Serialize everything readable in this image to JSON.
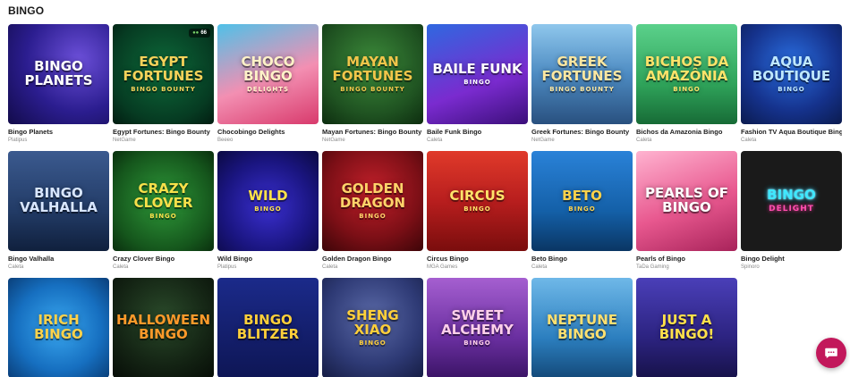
{
  "section": {
    "title": "BINGO"
  },
  "games": [
    {
      "name": "Bingo Planets",
      "provider": "Platipus",
      "art": "Bingo Planets"
    },
    {
      "name": "Egypt Fortunes: Bingo Bounty",
      "provider": "NetGame",
      "art": "Egypt Fortunes",
      "art_sub": "Bingo Bounty",
      "badge": "66"
    },
    {
      "name": "Chocobingo Delights",
      "provider": "Beeeo",
      "art": "Choco Bingo",
      "art_sub": "Delights"
    },
    {
      "name": "Mayan Fortunes: Bingo Bounty",
      "provider": "NetGame",
      "art": "Mayan Fortunes",
      "art_sub": "Bingo Bounty"
    },
    {
      "name": "Baile Funk Bingo",
      "provider": "Caleta",
      "art": "Baile Funk",
      "art_sub": "Bingo"
    },
    {
      "name": "Greek Fortunes: Bingo Bounty",
      "provider": "NetGame",
      "art": "Greek Fortunes",
      "art_sub": "Bingo Bounty"
    },
    {
      "name": "Bichos da Amazonia Bingo",
      "provider": "Caleta",
      "art": "Bichos da Amazônia",
      "art_sub": "Bingo"
    },
    {
      "name": "Fashion TV Aqua Boutique Bingo",
      "provider": "Caleta",
      "art": "Aqua Boutique",
      "art_sub": "Bingo"
    },
    {
      "name": "Bingo Valhalla",
      "provider": "Caleta",
      "art": "Bingo Valhalla"
    },
    {
      "name": "Crazy Clover Bingo",
      "provider": "Caleta",
      "art": "Crazy Clover",
      "art_sub": "Bingo"
    },
    {
      "name": "Wild Bingo",
      "provider": "Platipus",
      "art": "Wild",
      "art_sub": "Bingo"
    },
    {
      "name": "Golden Dragon Bingo",
      "provider": "Caleta",
      "art": "Golden Dragon",
      "art_sub": "Bingo"
    },
    {
      "name": "Circus Bingo",
      "provider": "MGA Games",
      "art": "Circus",
      "art_sub": "Bingo"
    },
    {
      "name": "Beto Bingo",
      "provider": "Caleta",
      "art": "Beto",
      "art_sub": "Bingo"
    },
    {
      "name": "Pearls of Bingo",
      "provider": "TaDa Gaming",
      "art": "Pearls of Bingo"
    },
    {
      "name": "Bingo Delight",
      "provider": "Spinoro",
      "art": "Bingo",
      "art_sub": "Delight"
    },
    {
      "name": "",
      "provider": "",
      "art": "iRich Bingo"
    },
    {
      "name": "",
      "provider": "",
      "art": "Halloween Bingo"
    },
    {
      "name": "",
      "provider": "",
      "art": "Bingo Blitzer"
    },
    {
      "name": "",
      "provider": "",
      "art": "Sheng Xiao",
      "art_sub": "Bingo"
    },
    {
      "name": "",
      "provider": "",
      "art": "Sweet Alchemy",
      "art_sub": "Bingo"
    },
    {
      "name": "",
      "provider": "",
      "art": "Neptune Bingo"
    },
    {
      "name": "",
      "provider": "",
      "art": "Just a Bingo!"
    }
  ],
  "chat": {
    "icon": "chat-bubble-icon",
    "color": "#c2185b"
  }
}
